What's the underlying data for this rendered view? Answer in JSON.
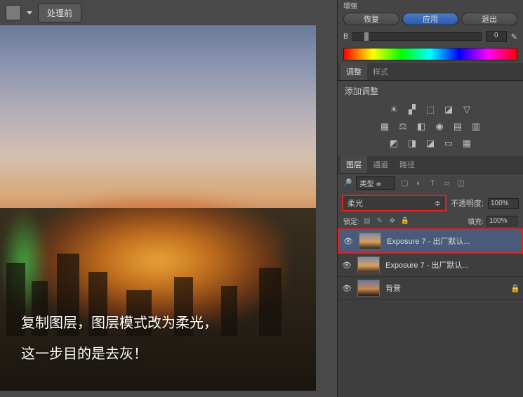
{
  "toolbar": {
    "before_label": "处理前"
  },
  "top_label": "增强",
  "actions": {
    "restore": "恢复",
    "apply": "应用",
    "exit": "退出"
  },
  "slider": {
    "label": "B",
    "value": "0"
  },
  "tabs": {
    "adjust": "调整",
    "style": "样式"
  },
  "adjustments": {
    "title": "添加调整"
  },
  "layer_tabs": {
    "layers": "图层",
    "channels": "通道",
    "paths": "路径"
  },
  "filter": {
    "type": "类型"
  },
  "blend": {
    "mode": "柔光",
    "opacity_label": "不透明度:",
    "opacity_value": "100%",
    "fill_label": "填充:",
    "fill_value": "100%",
    "lock_label": "锁定:"
  },
  "layers": [
    {
      "name": "Exposure 7 - 出厂默认...",
      "selected": true,
      "locked": false
    },
    {
      "name": "Exposure 7 - 出厂默认...",
      "selected": false,
      "locked": false
    },
    {
      "name": "背景",
      "selected": false,
      "locked": true
    }
  ],
  "overlay": {
    "line1": "复制图层，图层模式改为柔光，",
    "line2": "这一步目的是去灰！"
  }
}
